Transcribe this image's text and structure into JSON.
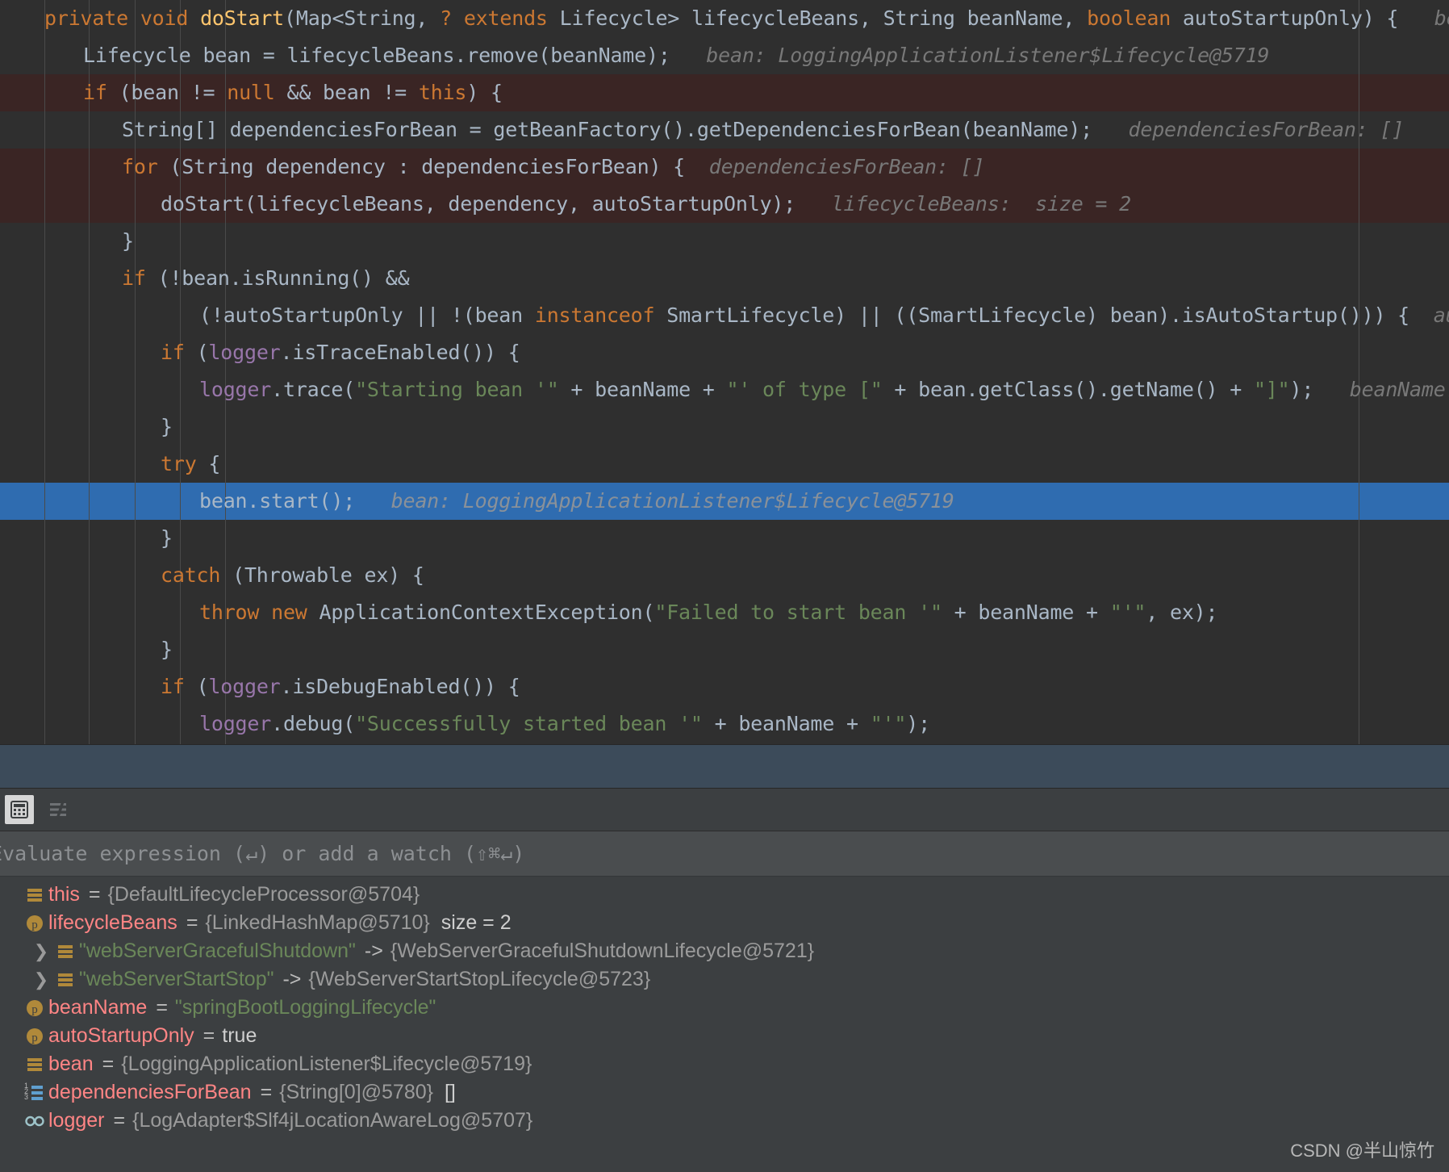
{
  "editor": {
    "font_size_px": 25,
    "colors": {
      "background": "#2f2f2f",
      "keyword": "#cc7832",
      "method": "#ffc66d",
      "field": "#9876aa",
      "string": "#6a8759",
      "plain": "#a9b7c6",
      "inline_hint": "#787878",
      "execution_highlight": "#3a2524",
      "selection_highlight": "#2f6cb0",
      "splitter_band": "#3c4b5a",
      "panel_background": "#3c3f41",
      "variable_name": "#ff8585"
    },
    "lines": [
      {
        "id": "line-signature",
        "indent": 0,
        "highlight": "none",
        "tokens": [
          {
            "t": "kw",
            "s": "private "
          },
          {
            "t": "kw",
            "s": "void "
          },
          {
            "t": "mth",
            "s": "doStart"
          },
          {
            "t": "pln",
            "s": "(Map<String, "
          },
          {
            "t": "kw",
            "s": "? extends "
          },
          {
            "t": "pln",
            "s": "Lifecycle> lifecycleBeans, String beanName, "
          },
          {
            "t": "kw",
            "s": "boolean "
          },
          {
            "t": "pln",
            "s": "autoStartupOnly) {"
          },
          {
            "t": "hint",
            "s": "   beanName:"
          }
        ]
      },
      {
        "id": "line-remove-bean",
        "indent": 1,
        "highlight": "none",
        "tokens": [
          {
            "t": "pln",
            "s": "Lifecycle bean = lifecycleBeans.remove(beanName);"
          },
          {
            "t": "hint",
            "s": "   bean: LoggingApplicationListener$Lifecycle@5719"
          }
        ]
      },
      {
        "id": "line-if-bean-not-null",
        "indent": 1,
        "highlight": "exec",
        "tokens": [
          {
            "t": "kw",
            "s": "if "
          },
          {
            "t": "pln",
            "s": "(bean != "
          },
          {
            "t": "kw",
            "s": "null "
          },
          {
            "t": "pln",
            "s": "&& bean != "
          },
          {
            "t": "kw",
            "s": "this"
          },
          {
            "t": "pln",
            "s": ") {"
          }
        ]
      },
      {
        "id": "line-dependencies",
        "indent": 2,
        "highlight": "none",
        "tokens": [
          {
            "t": "pln",
            "s": "String[] dependenciesForBean = getBeanFactory().getDependenciesForBean(beanName);"
          },
          {
            "t": "hint",
            "s": "   dependenciesForBean: []"
          }
        ]
      },
      {
        "id": "line-for-dependency",
        "indent": 2,
        "highlight": "exec",
        "tokens": [
          {
            "t": "kw",
            "s": "for "
          },
          {
            "t": "pln",
            "s": "(String dependency : dependenciesForBean) {"
          },
          {
            "t": "hint",
            "s": "  dependenciesForBean: []"
          }
        ]
      },
      {
        "id": "line-dostart-recurse",
        "indent": 3,
        "highlight": "exec",
        "tokens": [
          {
            "t": "pln",
            "s": "doStart(lifecycleBeans, dependency, autoStartupOnly);"
          },
          {
            "t": "hint",
            "s": "   lifecycleBeans:  size = 2"
          }
        ]
      },
      {
        "id": "line-close-for",
        "indent": 2,
        "highlight": "none",
        "tokens": [
          {
            "t": "pln",
            "s": "}"
          }
        ]
      },
      {
        "id": "line-if-not-running",
        "indent": 2,
        "highlight": "none",
        "tokens": [
          {
            "t": "kw",
            "s": "if "
          },
          {
            "t": "pln",
            "s": "(!bean.isRunning() &&"
          }
        ]
      },
      {
        "id": "line-auto-startup-cond",
        "indent": 4,
        "highlight": "none",
        "tokens": [
          {
            "t": "pln",
            "s": "(!autoStartupOnly || !(bean "
          },
          {
            "t": "kw",
            "s": "instanceof "
          },
          {
            "t": "pln",
            "s": "SmartLifecycle) || ((SmartLifecycle) bean).isAutoStartup())) {"
          },
          {
            "t": "hint",
            "s": "  autoS"
          }
        ]
      },
      {
        "id": "line-if-trace-enabled",
        "indent": 3,
        "highlight": "none",
        "tokens": [
          {
            "t": "kw",
            "s": "if "
          },
          {
            "t": "pln",
            "s": "("
          },
          {
            "t": "fld",
            "s": "logger"
          },
          {
            "t": "pln",
            "s": ".isTraceEnabled()) {"
          }
        ]
      },
      {
        "id": "line-logger-trace",
        "indent": 4,
        "highlight": "none",
        "tokens": [
          {
            "t": "fld",
            "s": "logger"
          },
          {
            "t": "pln",
            "s": ".trace("
          },
          {
            "t": "str",
            "s": "\"Starting bean '\""
          },
          {
            "t": "pln",
            "s": " + beanName + "
          },
          {
            "t": "str",
            "s": "\"' of type [\""
          },
          {
            "t": "pln",
            "s": " + bean.getClass().getName() + "
          },
          {
            "t": "str",
            "s": "\"]\""
          },
          {
            "t": "pln",
            "s": ");"
          },
          {
            "t": "hint",
            "s": "   beanName: \"sp"
          }
        ]
      },
      {
        "id": "line-close-trace-if",
        "indent": 3,
        "highlight": "none",
        "tokens": [
          {
            "t": "pln",
            "s": "}"
          }
        ]
      },
      {
        "id": "line-try",
        "indent": 3,
        "highlight": "none",
        "tokens": [
          {
            "t": "kw",
            "s": "try "
          },
          {
            "t": "pln",
            "s": "{"
          }
        ]
      },
      {
        "id": "line-bean-start",
        "indent": 4,
        "highlight": "selected",
        "tokens": [
          {
            "t": "pln",
            "s": "bean.start();"
          },
          {
            "t": "hint-b",
            "s": "   bean: LoggingApplicationListener$Lifecycle@5719"
          }
        ]
      },
      {
        "id": "line-close-try",
        "indent": 3,
        "highlight": "none",
        "tokens": [
          {
            "t": "pln",
            "s": "}"
          }
        ]
      },
      {
        "id": "line-catch",
        "indent": 3,
        "highlight": "none",
        "tokens": [
          {
            "t": "kw",
            "s": "catch "
          },
          {
            "t": "pln",
            "s": "(Throwable ex) {"
          }
        ]
      },
      {
        "id": "line-throw",
        "indent": 4,
        "highlight": "none",
        "tokens": [
          {
            "t": "kw",
            "s": "throw new "
          },
          {
            "t": "pln",
            "s": "ApplicationContextException("
          },
          {
            "t": "str",
            "s": "\"Failed to start bean '\""
          },
          {
            "t": "pln",
            "s": " + beanName + "
          },
          {
            "t": "str",
            "s": "\"'\""
          },
          {
            "t": "pln",
            "s": ", ex);"
          }
        ]
      },
      {
        "id": "line-close-catch",
        "indent": 3,
        "highlight": "none",
        "tokens": [
          {
            "t": "pln",
            "s": "}"
          }
        ]
      },
      {
        "id": "line-if-debug-enabled",
        "indent": 3,
        "highlight": "none",
        "tokens": [
          {
            "t": "kw",
            "s": "if "
          },
          {
            "t": "pln",
            "s": "("
          },
          {
            "t": "fld",
            "s": "logger"
          },
          {
            "t": "pln",
            "s": ".isDebugEnabled()) {"
          }
        ]
      },
      {
        "id": "line-logger-debug",
        "indent": 4,
        "highlight": "none",
        "tokens": [
          {
            "t": "fld",
            "s": "logger"
          },
          {
            "t": "pln",
            "s": ".debug("
          },
          {
            "t": "str",
            "s": "\"Successfully started bean '\""
          },
          {
            "t": "pln",
            "s": " + beanName + "
          },
          {
            "t": "str",
            "s": "\"'\""
          },
          {
            "t": "pln",
            "s": ");"
          }
        ]
      }
    ]
  },
  "debug_panel": {
    "toolbar": {
      "buttons": [
        {
          "name": "evaluate-expression-icon",
          "label": "calculator-icon",
          "active": true
        },
        {
          "name": "sort-values-icon",
          "label": "sort-lines-icon",
          "active": false
        }
      ]
    },
    "evaluate": {
      "placeholder": "Evaluate expression (↵) or add a watch (⇧⌘↵)",
      "value": ""
    },
    "variables": [
      {
        "name": "this",
        "icon": "object-field-icon",
        "expandable": false,
        "child": false,
        "eq": "=",
        "value": "{DefaultLifecycleProcessor@5704}",
        "value_type": "ref",
        "extra": ""
      },
      {
        "name": "lifecycleBeans",
        "icon": "parameter-icon",
        "expandable": false,
        "child": false,
        "eq": "=",
        "value": "{LinkedHashMap@5710}",
        "value_type": "ref",
        "extra": "size = 2"
      },
      {
        "name": "\"webServerGracefulShutdown\"",
        "icon": "object-field-icon",
        "expandable": true,
        "child": true,
        "eq": "->",
        "value": "{WebServerGracefulShutdownLifecycle@5721}",
        "value_type": "ref",
        "name_type": "string",
        "extra": ""
      },
      {
        "name": "\"webServerStartStop\"",
        "icon": "object-field-icon",
        "expandable": true,
        "child": true,
        "eq": "->",
        "value": "{WebServerStartStopLifecycle@5723}",
        "value_type": "ref",
        "name_type": "string",
        "extra": ""
      },
      {
        "name": "beanName",
        "icon": "parameter-icon",
        "expandable": false,
        "child": false,
        "eq": "=",
        "value": "\"springBootLoggingLifecycle\"",
        "value_type": "string",
        "extra": ""
      },
      {
        "name": "autoStartupOnly",
        "icon": "parameter-icon",
        "expandable": false,
        "child": false,
        "eq": "=",
        "value": "true",
        "value_type": "plain",
        "extra": ""
      },
      {
        "name": "bean",
        "icon": "object-field-icon",
        "expandable": false,
        "child": false,
        "eq": "=",
        "value": "{LoggingApplicationListener$Lifecycle@5719}",
        "value_type": "ref",
        "extra": ""
      },
      {
        "name": "dependenciesForBean",
        "icon": "array-icon",
        "expandable": false,
        "child": false,
        "eq": "=",
        "value": "{String[0]@5780}",
        "value_type": "ref",
        "extra": "[]"
      },
      {
        "name": "logger",
        "icon": "watch-glasses-icon",
        "expandable": false,
        "child": false,
        "eq": "=",
        "value": "{LogAdapter$Slf4jLocationAwareLog@5707}",
        "value_type": "ref",
        "extra": ""
      }
    ]
  },
  "watermark": {
    "text": "CSDN @半山惊竹"
  }
}
